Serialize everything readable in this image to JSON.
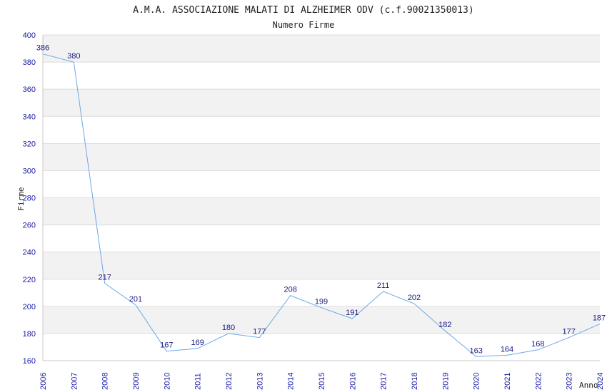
{
  "chart_data": {
    "type": "line",
    "title": "A.M.A. ASSOCIAZIONE MALATI DI ALZHEIMER ODV (c.f.90021350013)",
    "subtitle": "Numero Firme",
    "xlabel": "Anno",
    "ylabel": "Firme",
    "categories": [
      "2006",
      "2007",
      "2008",
      "2009",
      "2010",
      "2011",
      "2012",
      "2013",
      "2014",
      "2015",
      "2016",
      "2017",
      "2018",
      "2019",
      "2020",
      "2021",
      "2022",
      "2023",
      "2024"
    ],
    "series": [
      {
        "values": [
          386,
          380,
          217,
          201,
          167,
          169,
          180,
          177,
          208,
          199,
          191,
          211,
          202,
          182,
          163,
          164,
          168,
          177,
          187
        ]
      }
    ],
    "ylim": [
      160,
      400
    ],
    "yticks": [
      160,
      180,
      200,
      220,
      240,
      260,
      280,
      300,
      320,
      340,
      360,
      380,
      400
    ],
    "grid": true,
    "band_colors": [
      "#ffffff",
      "#f2f2f2"
    ],
    "line_color": "#6aa8e8",
    "tick_color": "#1a1aa6",
    "label_color": "#1a1a80"
  }
}
